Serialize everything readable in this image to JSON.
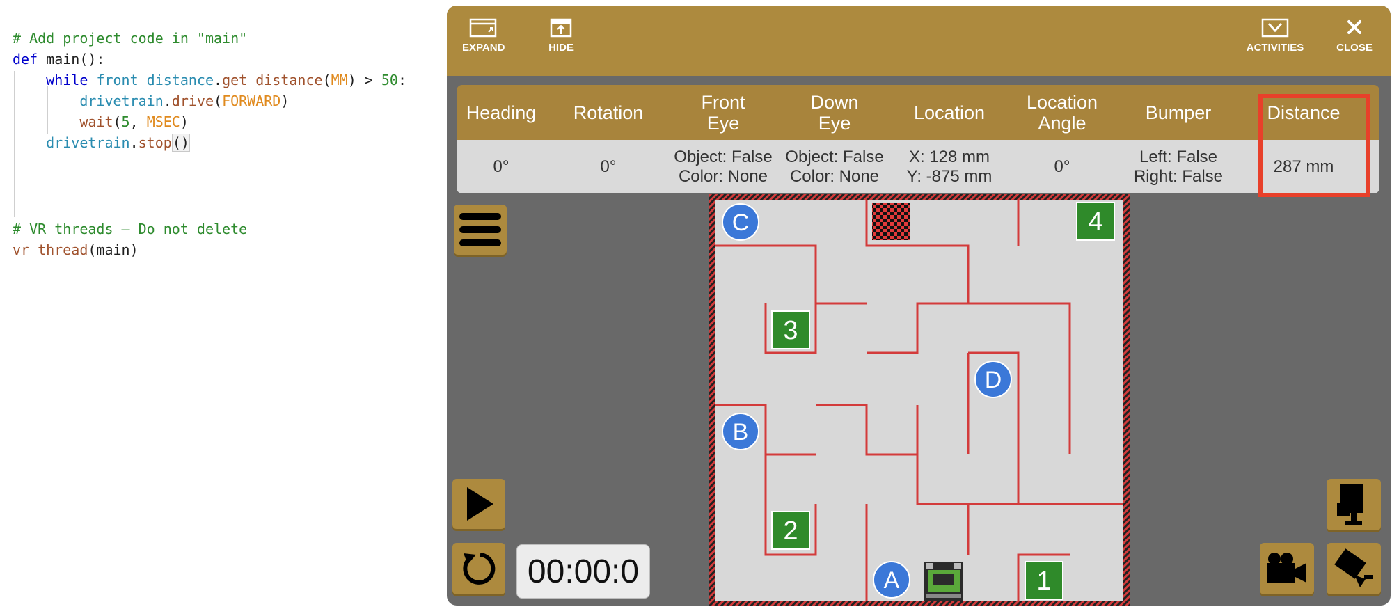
{
  "editor": {
    "lines": {
      "l1": "# Add project code in \"main\"",
      "l2_kw": "def",
      "l2_rest": " main():",
      "l3_kw": "while",
      "l3_mod": "front_distance",
      "l3_fn": "get_distance",
      "l3_const": "MM",
      "l3_num": "50",
      "l4_mod": "drivetrain",
      "l4_fn": "drive",
      "l4_const": "FORWARD",
      "l5_fn": "wait",
      "l5_num": "5",
      "l5_const": "MSEC",
      "l6_mod": "drivetrain",
      "l6_fn": "stop",
      "l7": "# VR threads — Do not delete",
      "l8_fn": "vr_thread",
      "l8_rest": "main"
    }
  },
  "toolbar": {
    "expand_label": "EXPAND",
    "hide_label": "HIDE",
    "activities_label": "ACTIVITIES",
    "close_label": "CLOSE"
  },
  "sensors": {
    "headers": {
      "heading": "Heading",
      "rotation": "Rotation",
      "front_eye_1": "Front",
      "front_eye_2": "Eye",
      "down_eye_1": "Down",
      "down_eye_2": "Eye",
      "location": "Location",
      "location_angle_1": "Location",
      "location_angle_2": "Angle",
      "bumper": "Bumper",
      "distance": "Distance"
    },
    "values": {
      "heading": "0°",
      "rotation": "0°",
      "front_eye_object": "Object: False",
      "front_eye_color": "Color: None",
      "down_eye_object": "Object: False",
      "down_eye_color": "Color: None",
      "location_x": "X: 128 mm",
      "location_y": "Y: -875 mm",
      "location_angle": "0°",
      "bumper_left": "Left: False",
      "bumper_right": "Right: False",
      "distance": "287 mm"
    }
  },
  "timer": {
    "value": "00:00:0"
  },
  "maze": {
    "circle_labels": {
      "a": "A",
      "b": "B",
      "c": "C",
      "d": "D"
    },
    "square_labels": {
      "one": "1",
      "two": "2",
      "three": "3",
      "four": "4"
    }
  },
  "colors": {
    "toolbar": "#ad8a3e",
    "panel": "#696969",
    "wall": "#d33b3b",
    "marker_green": "#2f8a2a",
    "marker_blue": "#3b78d8",
    "highlight": "#e8402a"
  },
  "icons": [
    "expand-icon",
    "hide-icon",
    "activities-icon",
    "close-icon",
    "menu-icon",
    "play-icon",
    "reset-icon",
    "camera-top-icon",
    "camera-follow-icon",
    "camera-side-icon",
    "checkered-flag-icon",
    "robot-icon"
  ]
}
